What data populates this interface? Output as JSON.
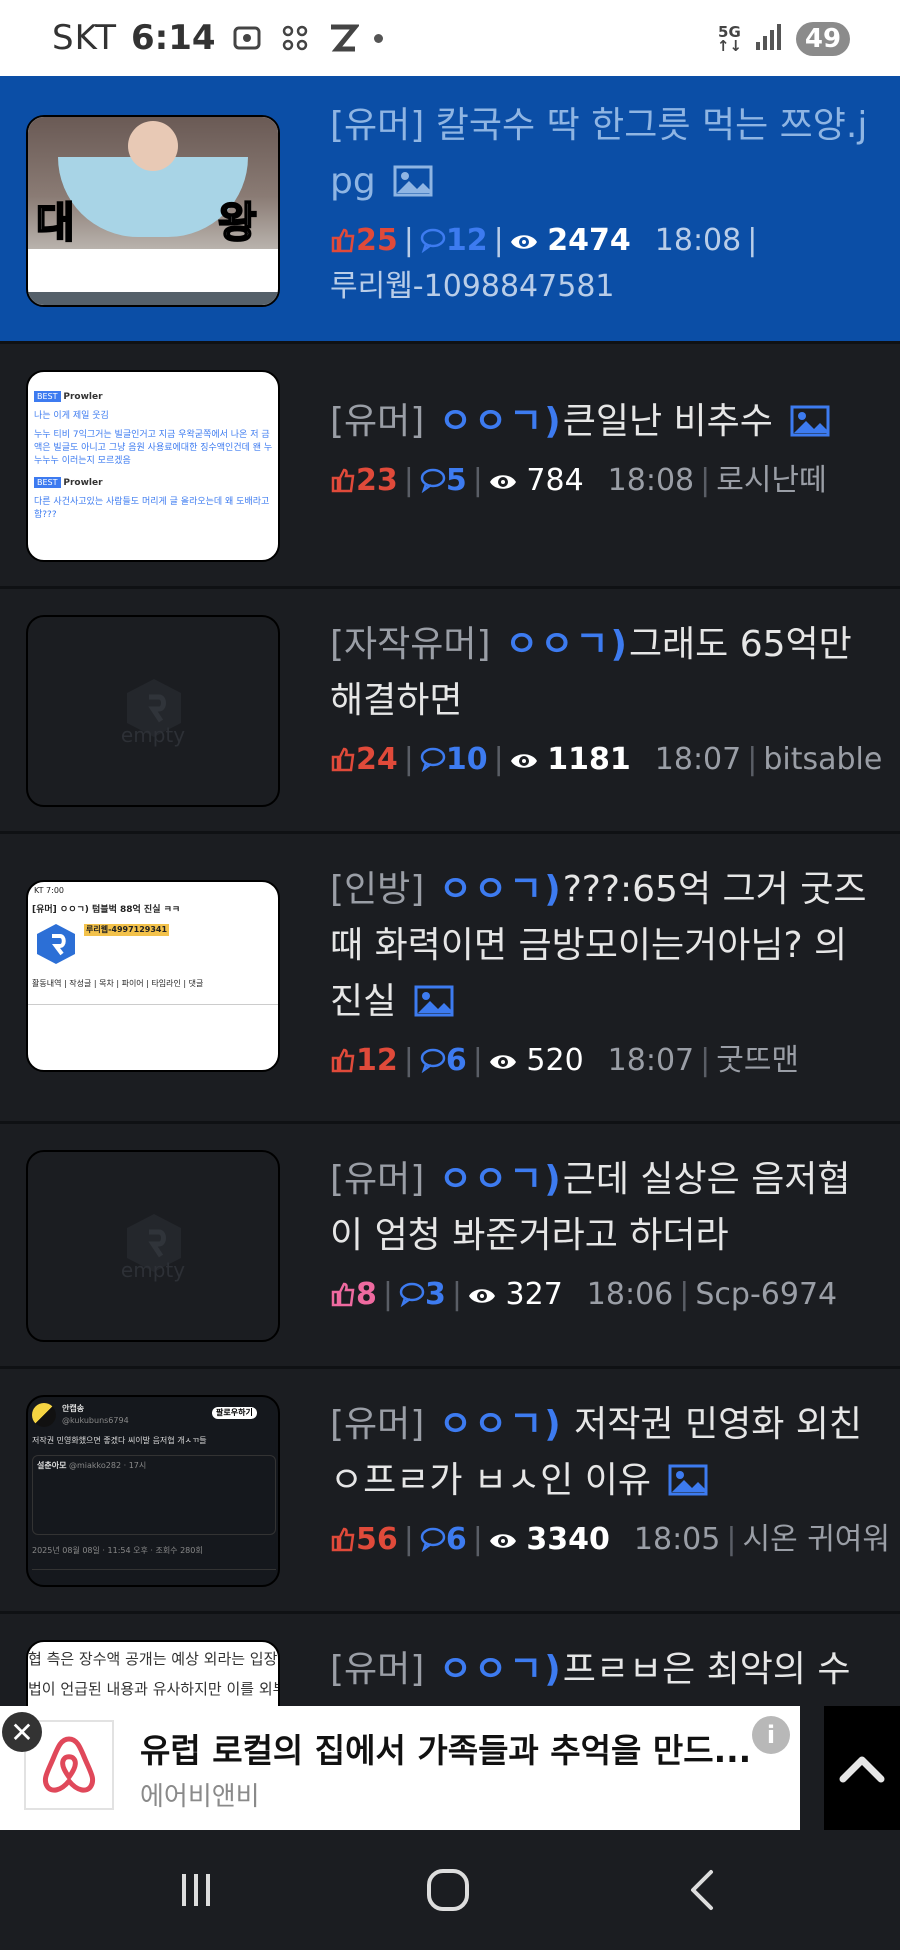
{
  "status_bar": {
    "carrier": "SKT",
    "time": "6:14",
    "network": "5G",
    "battery": "49"
  },
  "posts": [
    {
      "category": "[유머]",
      "tag": "",
      "title": " 칼국수 딱 한그릇 먹는 쯔양.jpg",
      "has_image_icon": true,
      "likes": "25",
      "comments": "12",
      "views": "2474",
      "time": "18:08",
      "author": "루리웹-1098847581",
      "thumb_text": [
        "대",
        "왕"
      ]
    },
    {
      "category": "[유머]",
      "tag": " ㅇㅇㄱ)",
      "title": "큰일난 비추수",
      "has_image_icon": true,
      "likes": "23",
      "comments": "5",
      "views": "784",
      "time": "18:08",
      "author": "로시난떼",
      "thumb_text": [
        "BEST",
        "Prowler",
        "나는 이게 제일 웃김",
        "누누 티비 7익그거는 빌글인거고 지금 우왁굳쪽에서 나온 저 금액은 빌글도 아니고 그냥 음원 사용료에대한 징수액인건데 왠 누누누누 이러는지 모르겠음",
        "BEST",
        "Prowler",
        "다른 사건사고있는 사람들도 머리게 글 올라오는데 왜 도배라고함???"
      ]
    },
    {
      "category": "[자작유머]",
      "tag": " ㅇㅇㄱ)",
      "title": "그래도 65억만 해결하면",
      "has_image_icon": false,
      "likes": "24",
      "comments": "10",
      "views": "1181",
      "time": "18:07",
      "author": "bitsable",
      "thumb_text": [
        "empty"
      ]
    },
    {
      "category": "[인방]",
      "tag": " ㅇㅇㄱ)",
      "title": "???:65억 그거 굿즈때 화력이면 금방모이는거아님? 의 진실",
      "has_image_icon": true,
      "likes": "12",
      "comments": "6",
      "views": "520",
      "time": "18:07",
      "author": "굿뜨맨",
      "thumb_text": [
        "KT 7:00",
        "[유머] ㅇㅇㄱ) 텀블벅 88억 진실 ㅋㅋ",
        "루리웹-4997129341",
        "활동내역 | 작성글 | 목차 | 파이어 | 타임라인 | 댓글"
      ]
    },
    {
      "category": "[유머]",
      "tag": " ㅇㅇㄱ)",
      "title": "근데 실상은 음저협이 엄청 봐준거라고 하더라",
      "has_image_icon": false,
      "likes": "8",
      "comments": "3",
      "views": "327",
      "time": "18:06",
      "author": "Scp-6974",
      "thumb_text": [
        "empty"
      ]
    },
    {
      "category": "[유머]",
      "tag": " ㅇㅇㄱ)",
      "title": " 저작권 민영화 외친 ㅇ프ㄹ가 ㅂㅅ인 이유",
      "has_image_icon": true,
      "likes": "56",
      "comments": "6",
      "views": "3340",
      "time": "18:05",
      "author": "시온 귀여워",
      "thumb_text": [
        "안캡송",
        "@kukubuns6794",
        "팔로우하기",
        "저작권 민영화했으면 좋겠다 씨이발 음저협 개ㅅㄲ들",
        "설춘아모",
        "@miakko282 · 17시",
        "2025년 08월 08일 · 11:54 오후 · 조회수 280회"
      ]
    },
    {
      "category": "[유머]",
      "tag": " ㅇㅇㄱ)",
      "title": "프ㄹㅂ은 최악의 수를 둔거 같다",
      "has_image_icon": true,
      "likes": "",
      "comments": "",
      "views": "",
      "time": "",
      "author": "",
      "thumb_text": [
        "협 측은 장수액 공개는 예상 외라는 입장",
        "법이 언급된 내용과 유사하지만 이를 외부"
      ]
    }
  ],
  "ad": {
    "title": "유럽 로컬의 집에서 가족들과 추억을 만드...",
    "advertiser": "에어비앤비",
    "info": "i"
  },
  "icons": {
    "like": "thumbs-up-icon",
    "comment": "comment-bubble-icon",
    "view": "eye-icon",
    "image": "image-icon"
  }
}
